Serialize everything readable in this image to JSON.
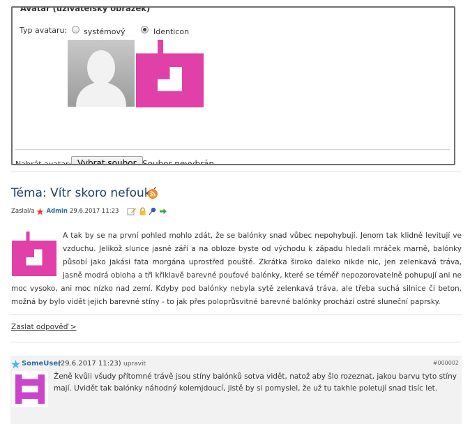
{
  "avatar_form": {
    "legend": "Avatar (uživatelský obrázek)",
    "type_label": "Typ avataru:",
    "options": [
      {
        "label": "systémový",
        "selected": false
      },
      {
        "label": "Identicon",
        "selected": true
      }
    ],
    "upload_label": "Nahrát avatar:",
    "upload_button": "Vybrat soubor",
    "upload_status": "Soubor nevybrán"
  },
  "topic": {
    "title": "Téma: Vítr skoro nefouká",
    "posted_by_label": "Zaslal/a",
    "author": "Admin",
    "date": "29.6.2017 11:23",
    "body": "A tak by se na první pohled mohlo zdát, že se balónky snad vůbec nepohybují. Jenom tak klidně levitují ve vzduchu. Jelikož slunce jasně září a na obloze byste od východu k západu hledali mráček marně, balónky působí jako jakási fata morgána uprostřed pouště. Zkrátka široko daleko nikde nic, jen zelenkavá tráva, jasně modrá obloha a tři křiklavě barevné pouťové balónky, které se téměř nepozorovatelně pohupují ani ne moc vysoko, ani moc nízko nad zemí. Kdyby pod balónky nebyla sytě zelenkavá tráva, ale třeba suchá silnice či beton, možná by bylo vidět jejich barevné stíny - to jak přes poloprůsvitné barevné balónky prochází ostré sluneční paprsky.",
    "reply_link": "Zaslat odpověď >"
  },
  "comment": {
    "user": "SomeUser",
    "date": "(29.6.2017 11:23)",
    "edit": "upravit",
    "id": "#000002",
    "text": "Ženě kvůli všudy přítomné trávě jsou stíny balónků sotva vidět, natož aby šlo rozeznat, jakou barvu tyto stíny mají. Uvidět tak balónky náhodný kolemjdoucí, jistě by si pomyslel, že už tu takhle poletují snad tisíc let."
  },
  "colors": {
    "identicon_pink": "#e040a8",
    "identicon_purple": "#cc44cc",
    "link_blue": "#2a6f9e",
    "title": "#1f3f5f"
  },
  "icons": [
    "rss-icon",
    "admin-star-icon",
    "edit-icon",
    "lock-icon",
    "pin-icon",
    "move-arrow-icon",
    "user-star-icon"
  ]
}
